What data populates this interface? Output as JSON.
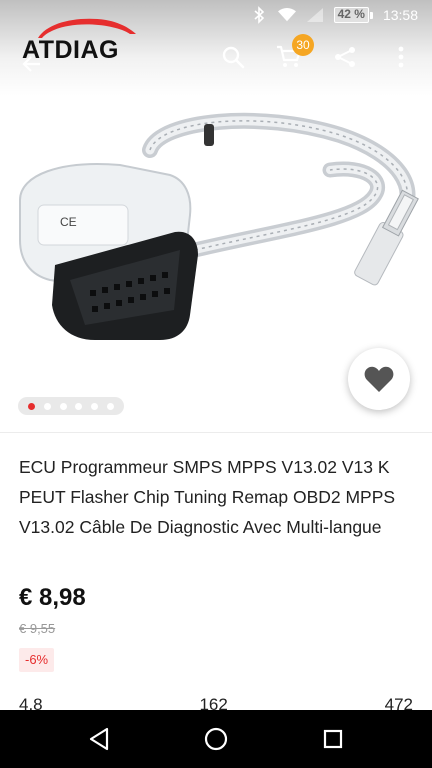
{
  "status_bar": {
    "battery": "42 %",
    "time": "13:58"
  },
  "app_bar": {
    "logo_text": "ATDIAG",
    "cart_count": "30"
  },
  "gallery": {
    "total_images": 6,
    "active_index": 0
  },
  "product": {
    "title": "ECU Programmeur SMPS MPPS V13.02 V13 K PEUT Flasher Chip Tuning Remap OBD2 MPPS V13.02 Câble De Diagnostic Avec Multi-langue",
    "price": "€ 8,98",
    "old_price": "€ 9,55",
    "discount": "-6%",
    "stats": [
      "4.8",
      "162",
      "472"
    ]
  },
  "colors": {
    "accent_red": "#e62e2e",
    "badge_orange": "#f5a623"
  }
}
